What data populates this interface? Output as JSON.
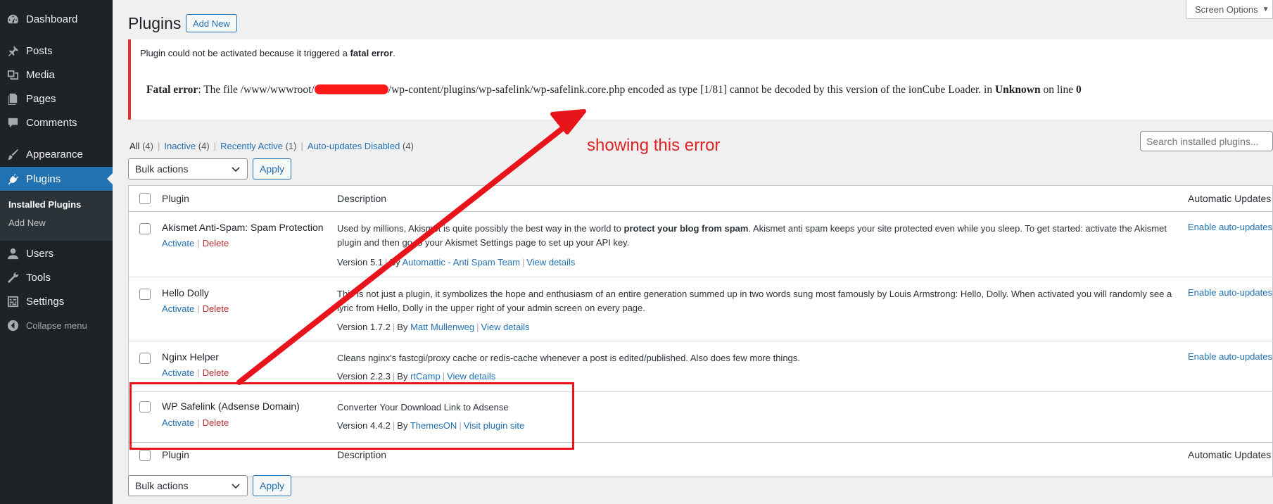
{
  "sidebar": {
    "items": [
      {
        "label": "Dashboard",
        "icon": "dashboard-icon"
      },
      {
        "label": "Posts",
        "icon": "pin-icon"
      },
      {
        "label": "Media",
        "icon": "media-icon"
      },
      {
        "label": "Pages",
        "icon": "pages-icon"
      },
      {
        "label": "Comments",
        "icon": "comment-icon"
      },
      {
        "label": "Appearance",
        "icon": "brush-icon"
      },
      {
        "label": "Plugins",
        "icon": "plugin-icon"
      },
      {
        "label": "Users",
        "icon": "user-icon"
      },
      {
        "label": "Tools",
        "icon": "wrench-icon"
      },
      {
        "label": "Settings",
        "icon": "settings-icon"
      }
    ],
    "submenu": {
      "installed": "Installed Plugins",
      "add_new": "Add New"
    },
    "collapse": "Collapse menu"
  },
  "header": {
    "screen_options": "Screen Options",
    "title": "Plugins",
    "add_new": "Add New"
  },
  "notice": {
    "msg_prefix": "Plugin could not be activated because it triggered a ",
    "msg_bold": "fatal error",
    "msg_suffix": ".",
    "fatal_label": "Fatal error",
    "fatal_part1": ": The file /www/wwwroot/",
    "fatal_part2": "/wp-content/plugins/wp-safelink/wp-safelink.core.php encoded as type [1/81] cannot be decoded by this version of the ionCube Loader. in ",
    "fatal_unknown": "Unknown",
    "fatal_part3": " on line ",
    "fatal_line": "0"
  },
  "annotation": {
    "text": "showing this error"
  },
  "filters": {
    "all": "All",
    "all_count": "(4)",
    "inactive": "Inactive",
    "inactive_count": "(4)",
    "recent": "Recently Active",
    "recent_count": "(1)",
    "autoupd": "Auto-updates Disabled",
    "autoupd_count": "(4)",
    "sep": "|"
  },
  "search": {
    "placeholder": "Search installed plugins..."
  },
  "bulk": {
    "label": "Bulk actions",
    "apply": "Apply"
  },
  "table": {
    "headers": {
      "plugin": "Plugin",
      "description": "Description",
      "auto": "Automatic Updates"
    },
    "activate": "Activate",
    "delete": "Delete",
    "sep": "|",
    "rows": [
      {
        "name": "Akismet Anti-Spam: Spam Protection",
        "desc_pre": "Used by millions, Akismet is quite possibly the best way in the world to ",
        "desc_bold": "protect your blog from spam",
        "desc_post": ". Akismet anti spam keeps your site protected even while you sleep. To get started: activate the Akismet plugin and then go to your Akismet Settings page to set up your API key.",
        "version": "Version 5.1",
        "by": "By",
        "author": "Automattic - Anti Spam Team",
        "link": "View details",
        "auto": "Enable auto-updates"
      },
      {
        "name": "Hello Dolly",
        "desc_pre": "This is not just a plugin, it symbolizes the hope and enthusiasm of an entire generation summed up in two words sung most famously by Louis Armstrong: Hello, Dolly. When activated you will randomly see a lyric from Hello, Dolly in the upper right of your admin screen on every page.",
        "desc_bold": "",
        "desc_post": "",
        "version": "Version 1.7.2",
        "by": "By",
        "author": "Matt Mullenweg",
        "link": "View details",
        "auto": "Enable auto-updates"
      },
      {
        "name": "Nginx Helper",
        "desc_pre": "Cleans nginx's fastcgi/proxy cache or redis-cache whenever a post is edited/published. Also does few more things.",
        "desc_bold": "",
        "desc_post": "",
        "version": "Version 2.2.3",
        "by": "By",
        "author": "rtCamp",
        "link": "View details",
        "auto": "Enable auto-updates"
      },
      {
        "name": "WP Safelink (Adsense Domain)",
        "desc_pre": "Converter Your Download Link to Adsense",
        "desc_bold": "",
        "desc_post": "",
        "version": "Version 4.4.2",
        "by": "By",
        "author": "ThemesON",
        "link": "Visit plugin site",
        "auto": ""
      }
    ]
  },
  "colors": {
    "accent": "#2271b1",
    "sidebar": "#1d2327",
    "error": "#d63638",
    "annotation": "#e8141c"
  }
}
